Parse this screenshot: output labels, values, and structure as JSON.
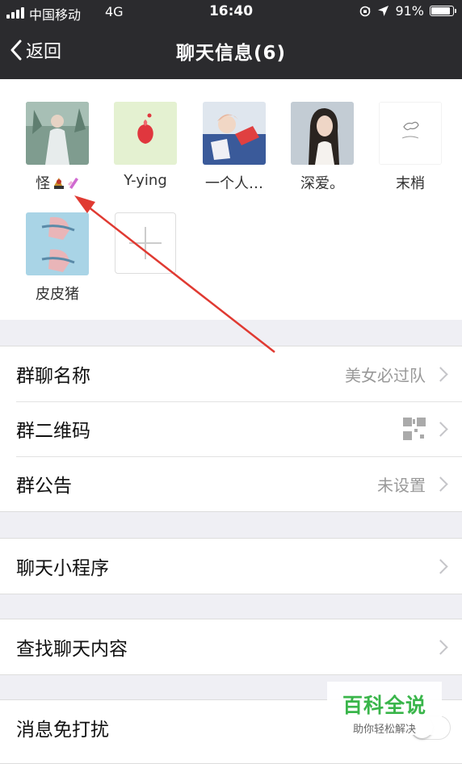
{
  "status_bar": {
    "carrier": "中国移动",
    "network": "4G",
    "time": "16:40",
    "battery_percent": "91%",
    "battery_level": 0.91
  },
  "nav": {
    "back_label": "返回",
    "title": "聊天信息(6)"
  },
  "members": [
    {
      "name": "怪",
      "avatar_color": "#8aa79a"
    },
    {
      "name": "Y-ying",
      "avatar_color": "#e4f1d1"
    },
    {
      "name": "一个人…",
      "avatar_color": "#b8c6dc"
    },
    {
      "name": "深爱。",
      "avatar_color": "#c8cfd6"
    },
    {
      "name": "末梢",
      "avatar_color": "#ffffff"
    },
    {
      "name": "皮皮猪",
      "avatar_color": "#a9d4e6"
    }
  ],
  "settings": {
    "group_name": {
      "label": "群聊名称",
      "value": "美女必过队"
    },
    "group_qr": {
      "label": "群二维码",
      "icon": "qr-code-icon"
    },
    "group_notice": {
      "label": "群公告",
      "value": "未设置"
    },
    "mini_programs": {
      "label": "聊天小程序"
    },
    "search_history": {
      "label": "查找聊天内容"
    },
    "do_not_disturb": {
      "label": "消息免打扰",
      "enabled": false
    }
  },
  "watermark": {
    "title": "百科全说",
    "subtitle": "助你轻松解决"
  },
  "colors": {
    "nav_bg": "#2b2b2e",
    "page_bg": "#efeff4",
    "annotation_arrow": "#e03a32",
    "watermark_green": "#39b54a"
  }
}
